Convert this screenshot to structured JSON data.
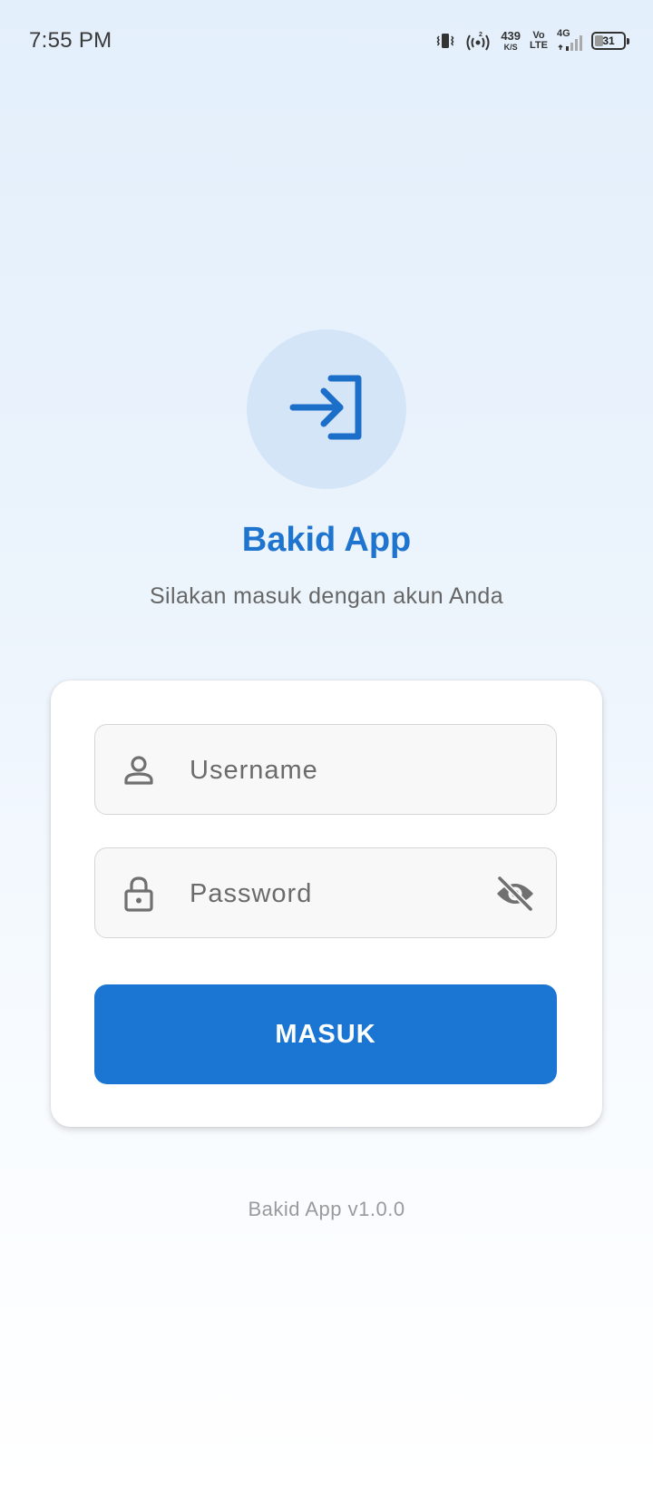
{
  "status_bar": {
    "time": "7:55 PM",
    "net_speed_value": "439",
    "net_speed_unit": "K/S",
    "volte_top": "Vo",
    "volte_bottom": "LTE",
    "network_type": "4G",
    "battery_percent": "31",
    "battery_level": 0.31,
    "icons": [
      "vibrate-icon",
      "hotspot-icon",
      "signal-icon",
      "battery-icon"
    ]
  },
  "header": {
    "logo_icon": "login-icon",
    "title": "Bakid App",
    "subtitle": "Silakan masuk dengan akun Anda"
  },
  "login_form": {
    "username": {
      "icon": "person-icon",
      "placeholder": "Username",
      "value": ""
    },
    "password": {
      "icon": "lock-icon",
      "placeholder": "Password",
      "value": "",
      "toggle_icon": "eye-off-icon"
    },
    "submit_label": "MASUK"
  },
  "footer": {
    "version": "Bakid App v1.0.0"
  },
  "colors": {
    "accent": "#1b76d3",
    "title": "#1e74cf",
    "logo_bg": "#d3e5f7",
    "background_top": "#e3effb",
    "background_bottom": "#ffffff"
  }
}
